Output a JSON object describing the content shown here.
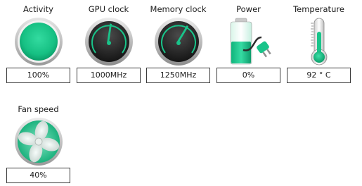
{
  "colors": {
    "accent": "#19c48a",
    "gauge_face": "#222222",
    "bezel": "#b8b8b8"
  },
  "tiles": [
    {
      "label": "Activity",
      "value": "100%",
      "icon": "activity-orb-icon"
    },
    {
      "label": "GPU clock",
      "value": "1000MHz",
      "icon": "gauge-icon",
      "gauge_level": 0.55
    },
    {
      "label": "Memory clock",
      "value": "1250MHz",
      "icon": "gauge-icon",
      "gauge_level": 0.7
    },
    {
      "label": "Power",
      "value": "0%",
      "icon": "battery-plug-icon"
    },
    {
      "label": "Temperature",
      "value": "92 ° C",
      "icon": "thermometer-icon"
    },
    {
      "label": "Fan speed",
      "value": "40%",
      "icon": "fan-icon"
    }
  ]
}
